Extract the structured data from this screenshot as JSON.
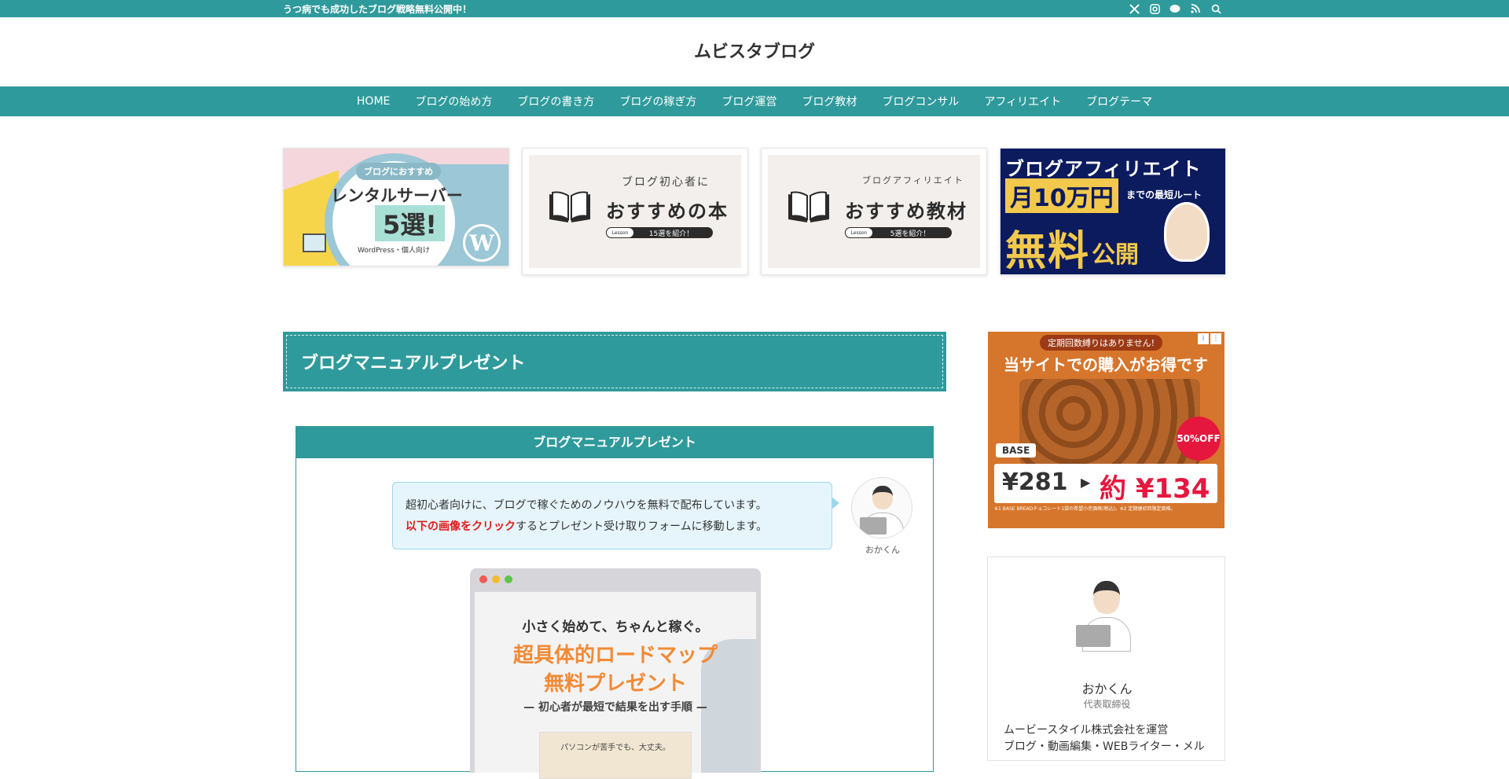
{
  "topbar": {
    "tagline": "うつ病でも成功したブログ戦略無料公開中！",
    "icons": [
      "x-icon",
      "instagram-icon",
      "line-icon",
      "rss-icon",
      "search-icon"
    ]
  },
  "site": {
    "title": "ムビスタブログ"
  },
  "nav": {
    "items": [
      "HOME",
      "ブログの始め方",
      "ブログの書き方",
      "ブログの稼ぎ方",
      "ブログ運営",
      "ブログ教材",
      "ブログコンサル",
      "アフィリエイト",
      "ブログテーマ"
    ]
  },
  "banners": {
    "b1": {
      "pill": "ブログにおすすめ",
      "title": "レンタルサーバー",
      "count": "5選!",
      "sub": "WordPress・個人向け",
      "logo": "W"
    },
    "b2": {
      "small": "ブログ初心者に",
      "big": "おすすめの本",
      "icon_label": "ブログ教材",
      "pill_left": "Lesson",
      "pill_right": "15選を紹介！"
    },
    "b3": {
      "small": "ブログアフィリエイト",
      "big": "おすすめ教材",
      "icon_label": "ブログ教材",
      "pill_left": "Lesson",
      "pill_right": "5選を紹介！"
    },
    "b4": {
      "line1": "ブログアフィリエイト",
      "line2": "月10万円",
      "line2_sub": "までの最短ルート",
      "line3": "無料",
      "line3_sub": "公開"
    }
  },
  "section": {
    "title": "ブログマニュアルプレゼント"
  },
  "box": {
    "head": "ブログマニュアルプレゼント",
    "bubble_line1": "超初心者向けに、ブログで稼ぐためのノウハウを無料で配布しています。",
    "bubble_red": "以下の画像をクリック",
    "bubble_line2_rest": "するとプレゼント受け取りフォームに移動します。",
    "avatar_name": "おかくん",
    "window": {
      "w1": "小さく始めて、ちゃんと稼ぐ。",
      "w2": "超具体的ロードマップ",
      "w3": "無料プレゼント",
      "w4": "— 初心者が最短で結果を出す手順 —",
      "card": "パソコンが苦手でも、大丈夫。"
    }
  },
  "ad": {
    "badge": "定期回数縛りはありません!",
    "headline": "当サイトでの購入がお得です",
    "sale": "50%OFF",
    "brand": "BASE",
    "price_old": "¥281",
    "price_new": "約 ¥134",
    "fine": "※1 BASE BREADチョコレート1袋の希望小売価格(税込)。※2 定期便初回限定価格。"
  },
  "profile": {
    "name": "おかくん",
    "role": "代表取締役",
    "desc1": "ムービースタイル株式会社を運営",
    "desc2": "ブログ・動画編集・WEBライター・メル"
  },
  "colors": {
    "brand": "#2f9a9b",
    "accent_red": "#e21a1a",
    "orange": "#f28a34"
  }
}
